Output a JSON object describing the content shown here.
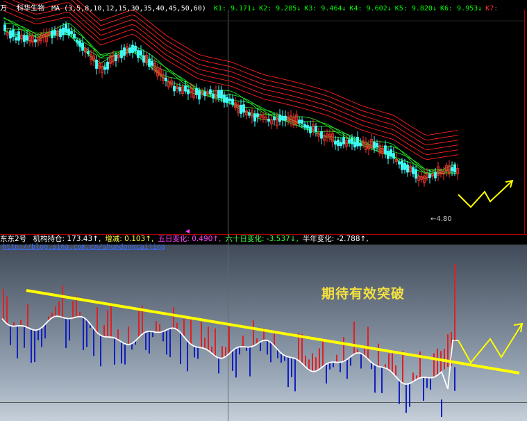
{
  "top_header": {
    "app_prefix": "万",
    "title": "科华生物",
    "indicator": "MA (3,5,8,10,12,15,30,35,40,45,50,60)",
    "k_values": [
      {
        "label": "K1:",
        "value": "9.171↓",
        "color": "#00ff00"
      },
      {
        "label": "K2:",
        "value": "9.285↓",
        "color": "#00ff00"
      },
      {
        "label": "K3:",
        "value": "9.464↓",
        "color": "#00ff00"
      },
      {
        "label": "K4:",
        "value": "9.602↓",
        "color": "#00ff00"
      },
      {
        "label": "K5:",
        "value": "9.820↓",
        "color": "#00ff00"
      },
      {
        "label": "K6:",
        "value": "9.953↓",
        "color": "#00ff00"
      },
      {
        "label": "K7:",
        "value": "",
        "color": "#ff3030"
      }
    ],
    "low_label": "←4.80"
  },
  "bottom_header": {
    "name": "东东2号",
    "items": [
      {
        "label": "机构持仓:",
        "value": "173.43↑,",
        "color": "#ffffff"
      },
      {
        "label": "增减:",
        "value": "0.103↑,",
        "color": "#ffff40"
      },
      {
        "label": "五日变化:",
        "value": "0.490↑,",
        "color": "#ff40ff"
      },
      {
        "label": "六十日变化:",
        "value": "-3.537↓,",
        "color": "#40ff40"
      },
      {
        "label": "半年变化:",
        "value": "-2.788↑,",
        "color": "#ffffff"
      }
    ],
    "url": "http://blog.sina.com.cn/shundongcaijing"
  },
  "annotation": "期待有效突破",
  "chart_data": [
    {
      "type": "line",
      "description_visible": "candlestick price with moving averages",
      "low_marker": 4.8,
      "series": [
        {
          "name": "K1",
          "last": 9.171
        },
        {
          "name": "K2",
          "last": 9.285
        },
        {
          "name": "K3",
          "last": 9.464
        },
        {
          "name": "K4",
          "last": 9.602
        },
        {
          "name": "K5",
          "last": 9.82
        },
        {
          "name": "K6",
          "last": 9.953
        }
      ],
      "trend_norm": [
        1.0,
        0.93,
        0.97,
        0.8,
        0.86,
        0.72,
        0.62,
        0.58,
        0.5,
        0.45,
        0.4,
        0.33,
        0.28,
        0.16,
        0.18
      ]
    },
    {
      "type": "bar",
      "description_visible": "机构持仓 indicator with red/blue bars, white line and yellow trendline",
      "last": 173.43,
      "change": 0.103,
      "five_day": 0.49,
      "sixty_day": -3.537,
      "half_year": -2.788
    }
  ],
  "colors": {
    "ma_red": "#ff2020",
    "ma_green": "#20e020",
    "candle_up": "#ff3030",
    "candle_down": "#40ffff",
    "bar_up": "#e02020",
    "bar_down": "#1020c0",
    "line": "#ffffff",
    "trend": "#ffff00",
    "projection": "#ffff00"
  }
}
